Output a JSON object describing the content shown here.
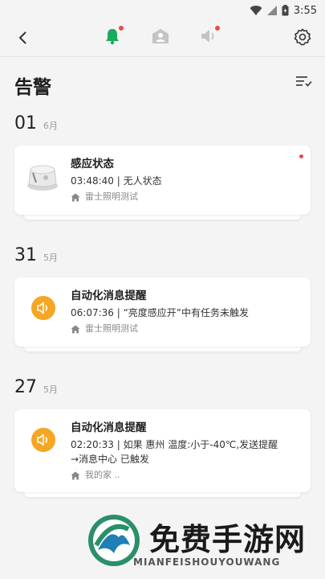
{
  "status_bar": {
    "time": "3:55"
  },
  "header": {
    "title": "告警"
  },
  "groups": [
    {
      "day": "01",
      "month": "6月",
      "card": {
        "icon": "sensor-device-icon",
        "title": "感应状态",
        "text": "03:48:40 | 无人状态",
        "location": "雷士照明测试",
        "unread": true
      }
    },
    {
      "day": "31",
      "month": "5月",
      "card": {
        "icon": "speaker-icon",
        "title": "自动化消息提醒",
        "text": "06:07:36 | “亮度感应开”中有任务未触发",
        "location": "雷士照明测试",
        "unread": false
      }
    },
    {
      "day": "27",
      "month": "5月",
      "card": {
        "icon": "speaker-icon",
        "title": "自动化消息提醒",
        "text_line1": "02:20:33 | 如果 惠州 温度:小于-40℃,发送提醒",
        "text_line2": "→消息中心 已触发",
        "location": "我的家 ..",
        "unread": false
      }
    }
  ],
  "watermark": {
    "title": "免费手游网",
    "subtitle": "MIANFEISHOUYOUWANG"
  },
  "colors": {
    "accent_green": "#1aab5b",
    "alert_orange": "#f5a623",
    "dot_red": "#f04848"
  }
}
